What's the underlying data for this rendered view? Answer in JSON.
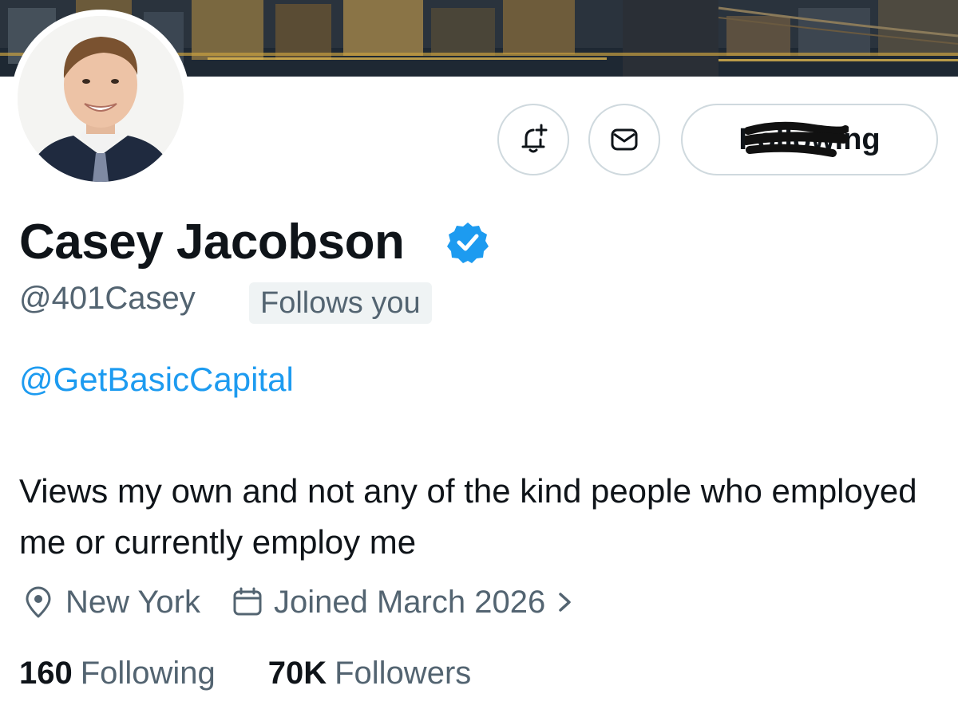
{
  "profile": {
    "display_name": "Casey Jacobson",
    "handle": "@401Casey",
    "follows_you_badge": "Follows you",
    "website": "@GetBasicCapital",
    "bio": "Views my own and not any of the kind people who employed me or currently employ me",
    "location": "New York",
    "joined": "Joined March 2026",
    "following_count": "160",
    "following_label": "Following",
    "followers_count": "70K",
    "followers_label": "Followers"
  },
  "actions": {
    "follow_button_label": "Following",
    "notify_icon": "bell-plus-icon",
    "message_icon": "envelope-icon"
  },
  "icons": {
    "verified": "verified-badge-icon",
    "location": "location-pin-icon",
    "calendar": "calendar-icon",
    "chevron": "chevron-right-icon"
  },
  "colors": {
    "accent": "#1d9bf0",
    "secondary_text": "#536471",
    "primary_text": "#0f1419",
    "border": "#cfd9de",
    "badge_bg": "#eff3f4"
  }
}
